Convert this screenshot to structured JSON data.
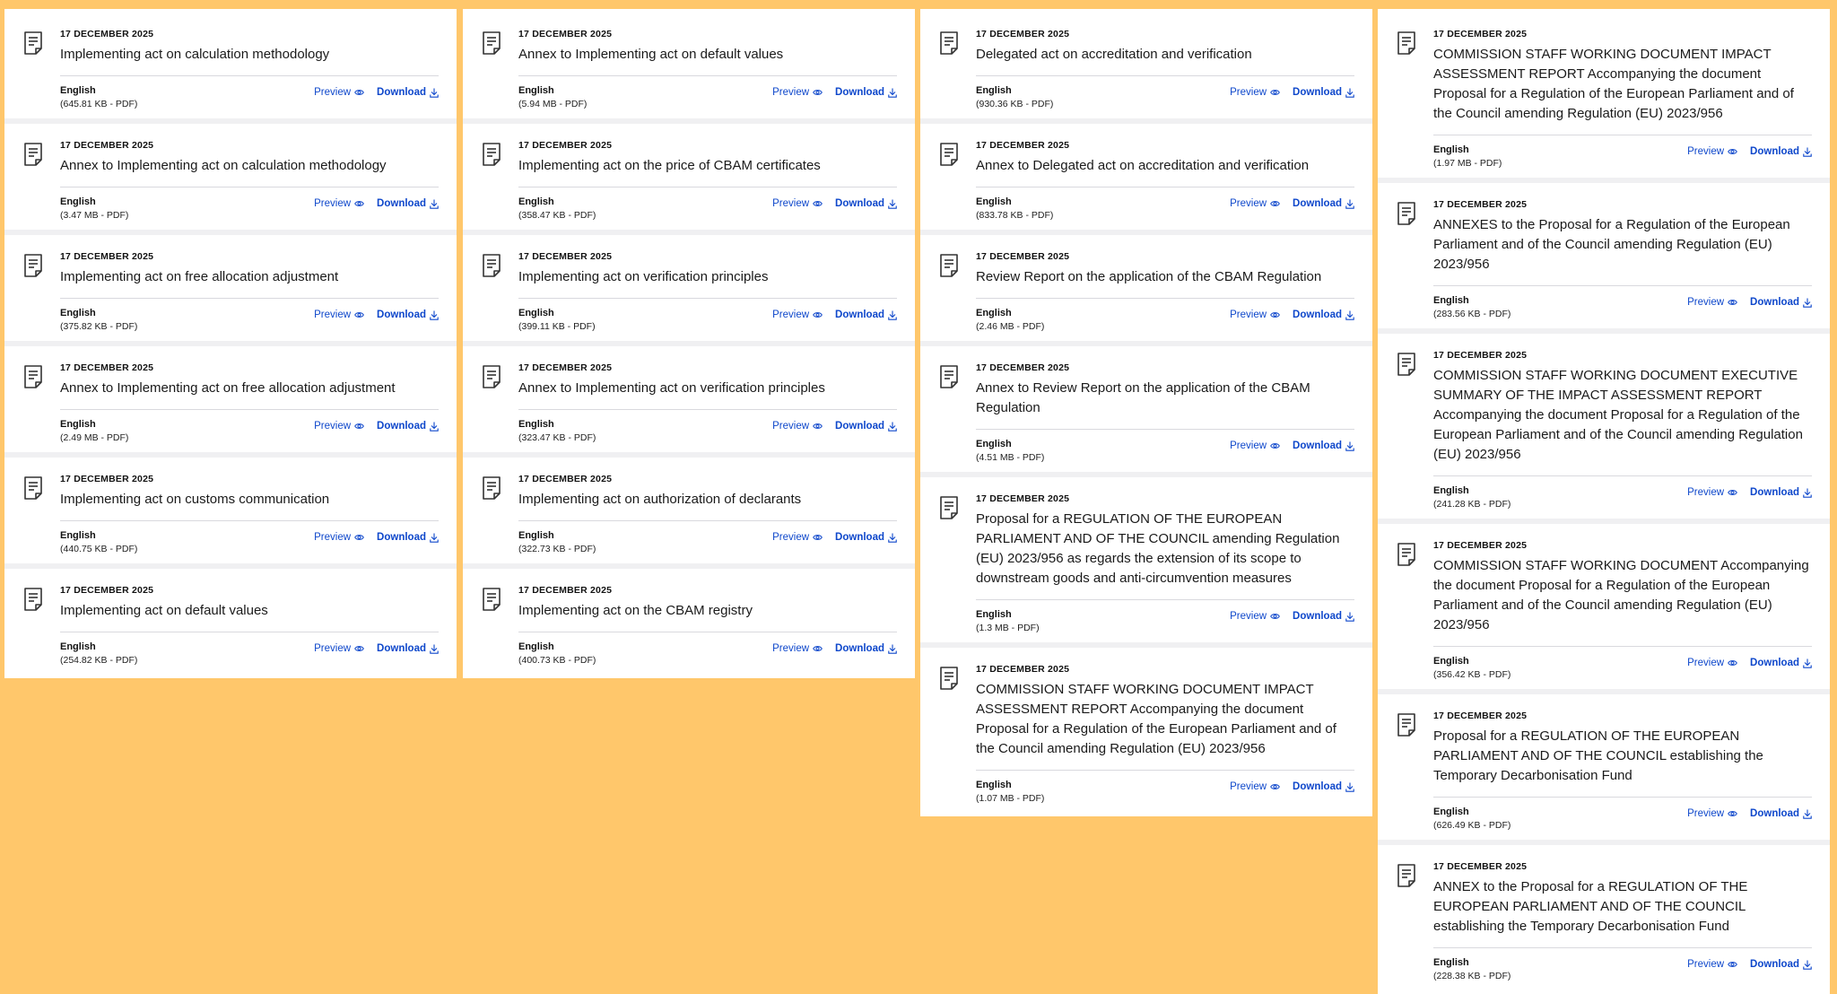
{
  "common": {
    "preview_label": "Preview",
    "download_label": "Download",
    "link_color": "#0e47cb",
    "background_color": "#ffc76b"
  },
  "columns": [
    {
      "cards": [
        {
          "date": "17 DECEMBER 2025",
          "title": "Implementing act on calculation methodology",
          "language": "English",
          "size": "(645.81 KB - PDF)"
        },
        {
          "date": "17 DECEMBER 2025",
          "title": "Annex to Implementing act on calculation methodology",
          "language": "English",
          "size": "(3.47 MB - PDF)"
        },
        {
          "date": "17 DECEMBER 2025",
          "title": "Implementing act on free allocation adjustment",
          "language": "English",
          "size": "(375.82 KB - PDF)"
        },
        {
          "date": "17 DECEMBER 2025",
          "title": "Annex to Implementing act on free allocation adjustment",
          "language": "English",
          "size": "(2.49 MB - PDF)"
        },
        {
          "date": "17 DECEMBER 2025",
          "title": "Implementing act on customs communication",
          "language": "English",
          "size": "(440.75 KB - PDF)"
        },
        {
          "date": "17 DECEMBER 2025",
          "title": "Implementing act on default values",
          "language": "English",
          "size": "(254.82 KB - PDF)"
        }
      ]
    },
    {
      "cards": [
        {
          "date": "17 DECEMBER 2025",
          "title": "Annex to Implementing act on default values",
          "language": "English",
          "size": "(5.94 MB - PDF)"
        },
        {
          "date": "17 DECEMBER 2025",
          "title": "Implementing act on the price of CBAM certificates",
          "language": "English",
          "size": "(358.47 KB - PDF)"
        },
        {
          "date": "17 DECEMBER 2025",
          "title": "Implementing act on verification principles",
          "language": "English",
          "size": "(399.11 KB - PDF)"
        },
        {
          "date": "17 DECEMBER 2025",
          "title": "Annex to Implementing act on verification principles",
          "language": "English",
          "size": "(323.47 KB - PDF)"
        },
        {
          "date": "17 DECEMBER 2025",
          "title": "Implementing act on authorization of declarants",
          "language": "English",
          "size": "(322.73 KB - PDF)"
        },
        {
          "date": "17 DECEMBER 2025",
          "title": "Implementing act on the CBAM registry",
          "language": "English",
          "size": "(400.73 KB - PDF)"
        }
      ]
    },
    {
      "cards": [
        {
          "date": "17 DECEMBER 2025",
          "title": "Delegated act on accreditation and verification",
          "language": "English",
          "size": "(930.36 KB - PDF)"
        },
        {
          "date": "17 DECEMBER 2025",
          "title": "Annex to Delegated act on accreditation and verification",
          "language": "English",
          "size": "(833.78 KB - PDF)"
        },
        {
          "date": "17 DECEMBER 2025",
          "title": "Review Report on the application of the CBAM Regulation",
          "language": "English",
          "size": "(2.46 MB - PDF)"
        },
        {
          "date": "17 DECEMBER 2025",
          "title": "Annex to Review Report on the application of the CBAM Regulation",
          "language": "English",
          "size": "(4.51 MB - PDF)"
        },
        {
          "date": "17 DECEMBER 2025",
          "title": "Proposal for a REGULATION OF THE EUROPEAN PARLIAMENT AND OF THE COUNCIL amending Regulation (EU) 2023/956 as regards the extension of its scope to downstream goods and anti-circumvention measures",
          "language": "English",
          "size": "(1.3 MB - PDF)"
        },
        {
          "date": "17 DECEMBER 2025",
          "title": "COMMISSION STAFF WORKING DOCUMENT IMPACT ASSESSMENT REPORT Accompanying the document Proposal for a Regulation of the European Parliament and of the Council amending Regulation (EU) 2023/956",
          "language": "English",
          "size": "(1.07 MB - PDF)"
        }
      ]
    },
    {
      "cards": [
        {
          "date": "17 DECEMBER 2025",
          "title": "COMMISSION STAFF WORKING DOCUMENT IMPACT ASSESSMENT REPORT Accompanying the document Proposal for a Regulation of the European Parliament and of the Council amending Regulation (EU) 2023/956",
          "language": "English",
          "size": "(1.97 MB - PDF)"
        },
        {
          "date": "17 DECEMBER 2025",
          "title": "ANNEXES to the Proposal for a Regulation of the European Parliament and of the Council amending Regulation (EU) 2023/956",
          "language": "English",
          "size": "(283.56 KB - PDF)"
        },
        {
          "date": "17 DECEMBER 2025",
          "title": "COMMISSION STAFF WORKING DOCUMENT EXECUTIVE SUMMARY OF THE IMPACT ASSESSMENT REPORT Accompanying the document Proposal for a Regulation of the European Parliament and of the Council amending Regulation (EU) 2023/956",
          "language": "English",
          "size": "(241.28 KB - PDF)"
        },
        {
          "date": "17 DECEMBER 2025",
          "title": "COMMISSION STAFF WORKING DOCUMENT Accompanying the document Proposal for a Regulation of the European Parliament and of the Council amending Regulation (EU) 2023/956",
          "language": "English",
          "size": "(356.42 KB - PDF)"
        },
        {
          "date": "17 DECEMBER 2025",
          "title": "Proposal for a REGULATION OF THE EUROPEAN PARLIAMENT AND OF THE COUNCIL establishing the Temporary Decarbonisation Fund",
          "language": "English",
          "size": "(626.49 KB - PDF)"
        },
        {
          "date": "17 DECEMBER 2025",
          "title": "ANNEX to the Proposal for a REGULATION OF THE EUROPEAN PARLIAMENT AND OF THE COUNCIL establishing the Temporary Decarbonisation Fund",
          "language": "English",
          "size": "(228.38 KB - PDF)"
        }
      ]
    }
  ]
}
